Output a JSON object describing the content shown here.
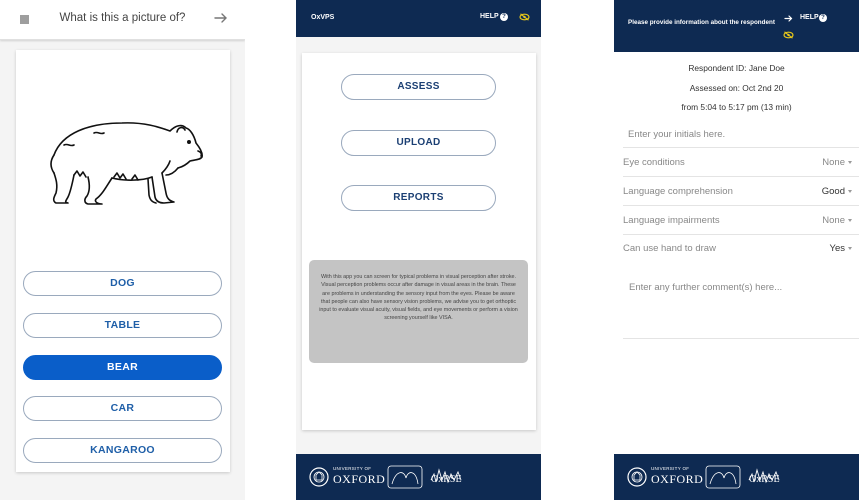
{
  "screen1": {
    "question": "What is this a picture of?",
    "picture_subject": "bear",
    "answers": [
      {
        "label": "DOG",
        "selected": false
      },
      {
        "label": "TABLE",
        "selected": false
      },
      {
        "label": "BEAR",
        "selected": true
      },
      {
        "label": "CAR",
        "selected": false
      },
      {
        "label": "KANGAROO",
        "selected": false
      }
    ]
  },
  "screen2": {
    "app_name": "OxVPS",
    "help_label": "HELP",
    "menu": [
      "ASSESS",
      "UPLOAD",
      "REPORTS"
    ],
    "info_text": "With this app you can screen for typical problems in visual perception after stroke. Visual perception problems occur after damage in visual areas in the brain. These are problems in understanding the sensory input from the eyes. Please be aware that people can also have sensory vision problems, we advise you to get orthoptic input to evaluate visual acuity, visual fields, and eye movements or perform a vision screening yourself like VISA."
  },
  "screen3": {
    "title": "Please provide information about the respondent",
    "help_label": "HELP",
    "respondent_id": "Respondent ID: Jane Doe",
    "assessed_on": "Assessed on: Oct 2nd 20",
    "time_range": "from 5:04 to 5:17 pm (13 min)",
    "initials_placeholder": "Enter your initials here.",
    "fields": [
      {
        "label": "Eye conditions",
        "value": "None"
      },
      {
        "label": "Language comprehension",
        "value": "Good"
      },
      {
        "label": "Language impairments",
        "value": "None"
      },
      {
        "label": "Can use hand to draw",
        "value": "Yes"
      }
    ],
    "comments_placeholder": "Enter any further comment(s) here..."
  },
  "footer": {
    "university_small": "UNIVERSITY OF",
    "university_name": "OXFORD",
    "group_name": "OxRSE"
  },
  "colors": {
    "navy": "#0e2a52",
    "accent_blue": "#0a5ec9",
    "button_text": "#1f5fa8",
    "eye_icon": "#e8c81a"
  }
}
